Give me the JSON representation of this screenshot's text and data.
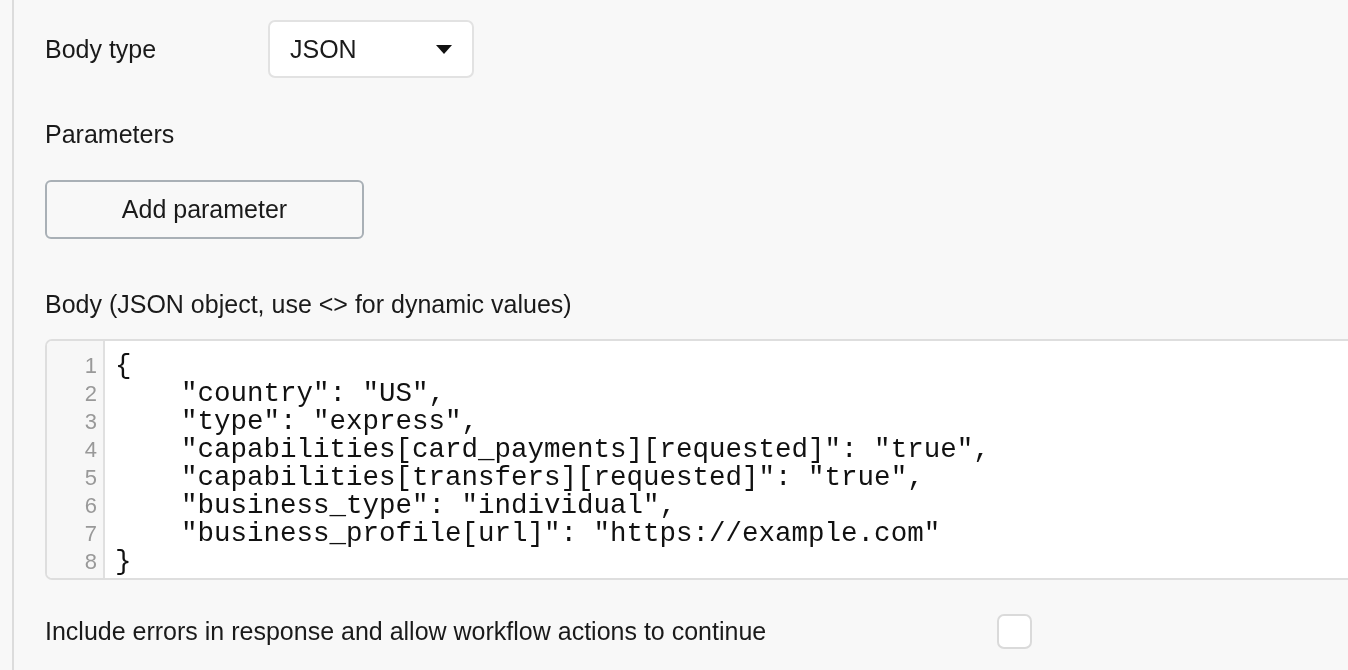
{
  "body_type": {
    "label": "Body type",
    "value": "JSON"
  },
  "parameters": {
    "label": "Parameters",
    "add_button": "Add parameter"
  },
  "body": {
    "label": "Body (JSON object, use <> for dynamic values)",
    "lines": [
      {
        "number": "1",
        "text": "{"
      },
      {
        "number": "2",
        "text": "    \"country\": \"US\","
      },
      {
        "number": "3",
        "text": "    \"type\": \"express\","
      },
      {
        "number": "4",
        "text": "    \"capabilities[card_payments][requested]\": \"true\","
      },
      {
        "number": "5",
        "text": "    \"capabilities[transfers][requested]\": \"true\","
      },
      {
        "number": "6",
        "text": "    \"business_type\": \"individual\","
      },
      {
        "number": "7",
        "text": "    \"business_profile[url]\": \"https://example.com\""
      },
      {
        "number": "8",
        "text": "}"
      }
    ]
  },
  "include_errors": {
    "label": "Include errors in response and allow workflow actions to continue",
    "checked": false
  }
}
